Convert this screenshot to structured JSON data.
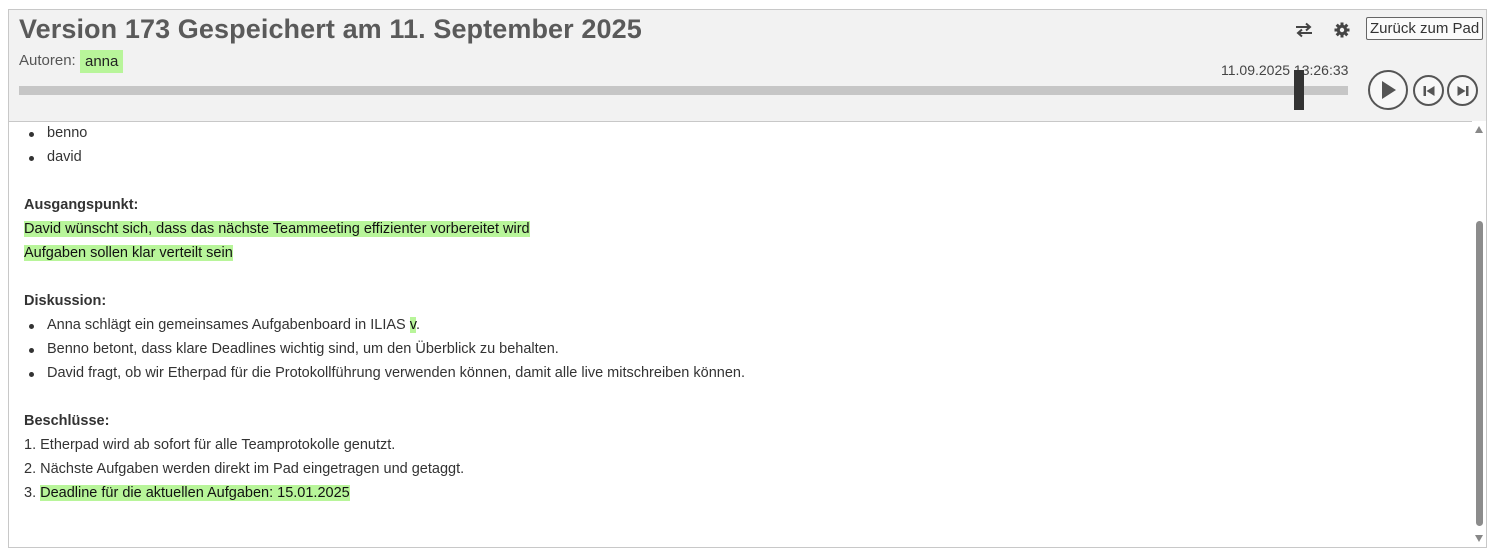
{
  "header": {
    "title": "Version 173 Gespeichert am 11. September 2025",
    "authors_label": "Autoren:",
    "authors": [
      "anna"
    ],
    "back_button": "Zurück zum Pad",
    "timestamp": "11.09.2025 13:26:33",
    "slider_value": 0.965
  },
  "content": {
    "intro_bullets": [
      "benno",
      "david"
    ],
    "section1_heading": "Ausgangspunkt:",
    "section1_lines": [
      "David wünscht sich, dass das nächste Teammeeting effizienter vorbereitet wird",
      "Aufgaben sollen klar verteilt sein"
    ],
    "section2_heading": "Diskussion:",
    "discussion": [
      {
        "text": "Anna schlägt ein gemeinsames Aufgabenboard in ILIAS ",
        "hl": "v",
        "tail": "."
      },
      {
        "text": "Benno betont, dass klare Deadlines wichtig sind, um den Überblick zu behalten."
      },
      {
        "text": "David fragt, ob wir Etherpad für die Protokollführung verwenden können, damit alle live mitschreiben können."
      }
    ],
    "section3_heading": "Beschlüsse:",
    "decisions": [
      {
        "num": "1.",
        "text": "Etherpad wird ab sofort für alle Teamprotokolle genutzt."
      },
      {
        "num": "2.",
        "text": "Nächste Aufgaben werden direkt im Pad eingetragen und getaggt."
      },
      {
        "num": "3.",
        "text": "Deadline für die aktuellen Aufgaben: 15.01.2025"
      }
    ]
  },
  "colors": {
    "author_highlight": "#b8f59a",
    "header_bg": "#f2f2f2"
  },
  "icons": {
    "swap": "swap-arrows-icon",
    "settings": "gear-icon",
    "play": "play-icon",
    "prev": "step-backward-icon",
    "next": "step-forward-icon"
  }
}
